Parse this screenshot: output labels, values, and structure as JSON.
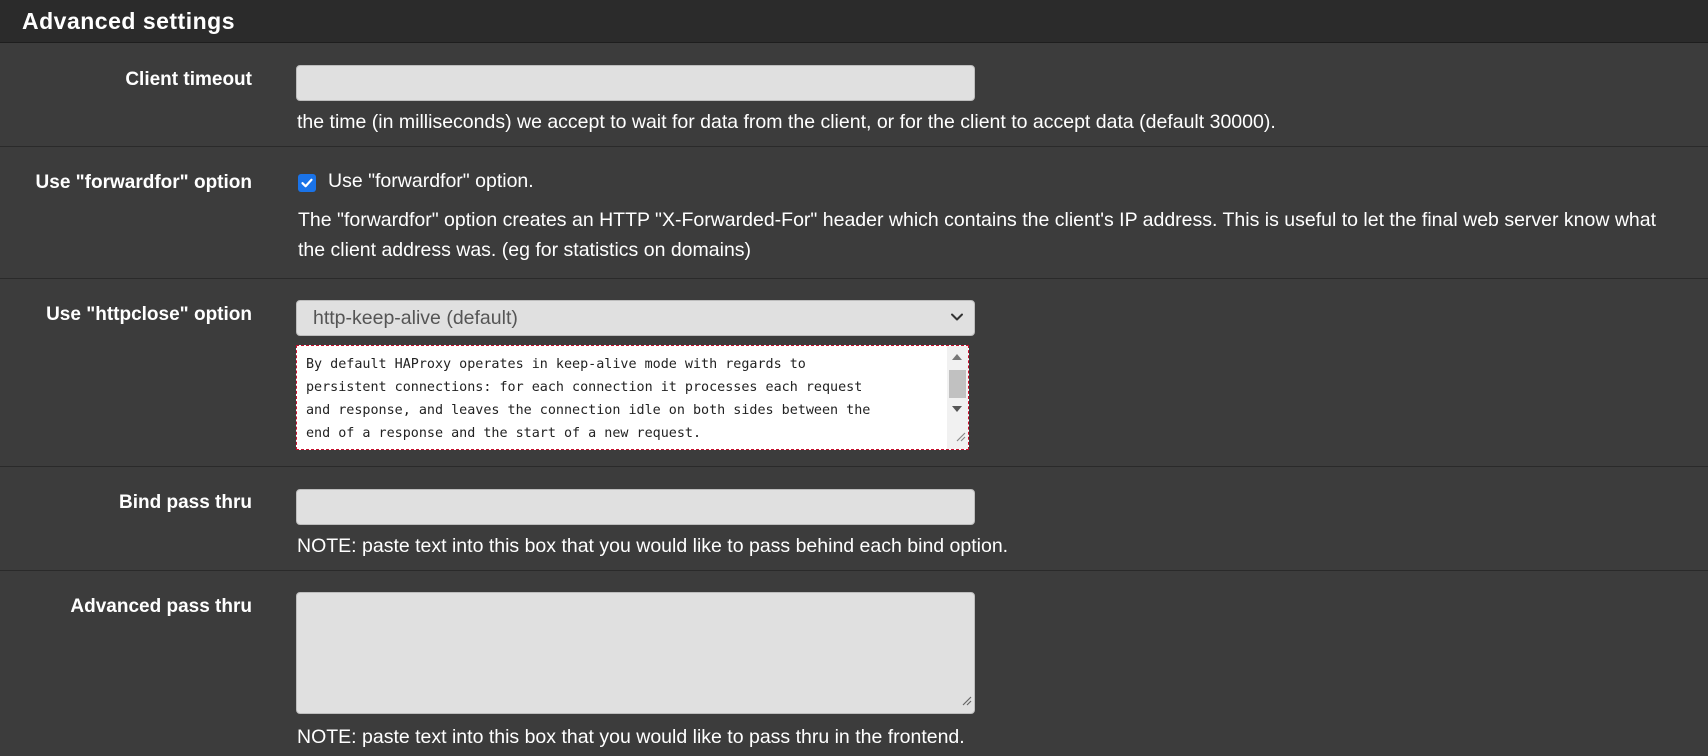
{
  "panel": {
    "title": "Advanced settings"
  },
  "client_timeout": {
    "label": "Client timeout",
    "value": "",
    "help": "the time (in milliseconds) we accept to wait for data from the client, or for the client to accept data (default 30000)."
  },
  "forwardfor": {
    "label": "Use \"forwardfor\" option",
    "checked": true,
    "checkbox_label": "Use \"forwardfor\" option.",
    "help": "The \"forwardfor\" option creates an HTTP \"X-Forwarded-For\" header which contains the client's IP address. This is useful to let the final web server know what the client address was. (eg for statistics on domains)"
  },
  "httpclose": {
    "label": "Use \"httpclose\" option",
    "selected": "http-keep-alive (default)",
    "description": "By default HAProxy operates in keep-alive mode with regards to\npersistent connections: for each connection it processes each request\nand response, and leaves the connection idle on both sides between the\nend of a response and the start of a new request."
  },
  "bind_pass_thru": {
    "label": "Bind pass thru",
    "value": "",
    "help": "NOTE: paste text into this box that you would like to pass behind each bind option."
  },
  "advanced_pass_thru": {
    "label": "Advanced pass thru",
    "value": "",
    "help": "NOTE: paste text into this box that you would like to pass thru in the frontend."
  },
  "colors": {
    "header_bg": "#2b2b2b",
    "panel_bg": "#3c3c3c",
    "input_bg": "#e0e0e0",
    "checkbox_accent": "#1a73e8"
  }
}
